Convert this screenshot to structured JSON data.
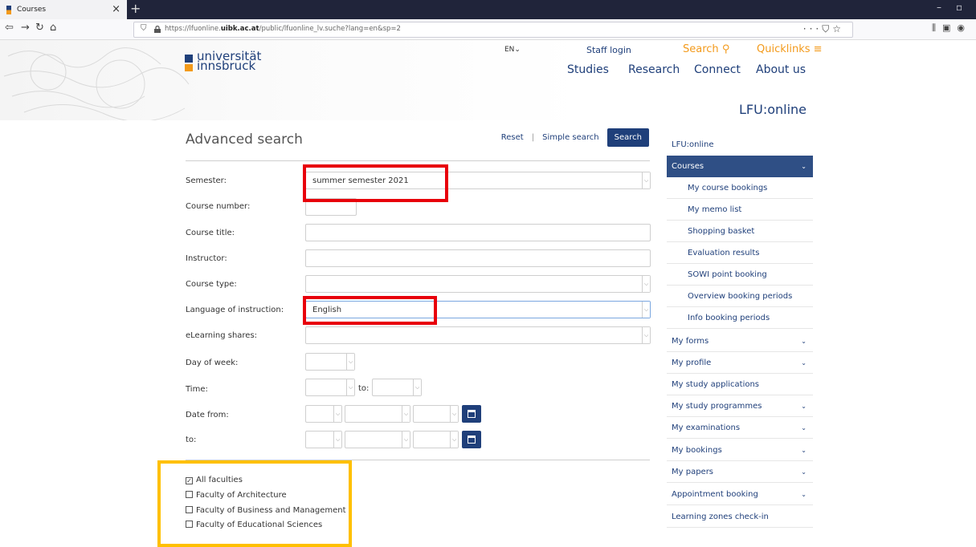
{
  "browser": {
    "tab_title": "Courses",
    "url_prefix": "https://lfuonline.",
    "url_domain": "uibk.ac.at",
    "url_rest": "/public/lfuonline_lv.suche?lang=en&sp=2",
    "new_tab": "+",
    "tab_close": "×"
  },
  "header": {
    "logo_line1": "universität",
    "logo_line2": "innsbruck",
    "lang": "EN",
    "staff_login": "Staff login",
    "search": "Search",
    "quicklinks": "Quicklinks",
    "nav": [
      "Studies",
      "Research",
      "Connect",
      "About us"
    ],
    "portal_title": "LFU:online"
  },
  "form": {
    "title": "Advanced search",
    "reset": "Reset",
    "divider": "|",
    "simple_search": "Simple search",
    "search_button": "Search",
    "labels": {
      "semester": "Semester:",
      "course_number": "Course number:",
      "course_title": "Course title:",
      "instructor": "Instructor:",
      "course_type": "Course type:",
      "language": "Language of instruction:",
      "elearning": "eLearning shares:",
      "day_of_week": "Day of week:",
      "time": "Time:",
      "time_to": "to:",
      "date_from": "Date from:",
      "date_to": "to:"
    },
    "values": {
      "semester": "summer semester 2021",
      "language": "English"
    },
    "faculties": [
      {
        "label": "All faculties",
        "checked": true
      },
      {
        "label": "Faculty of Architecture",
        "checked": false
      },
      {
        "label": "Faculty of Business and Management",
        "checked": false
      },
      {
        "label": "Faculty of Educational Sciences",
        "checked": false
      }
    ]
  },
  "sidebar": {
    "heading": "LFU:online",
    "items": [
      {
        "label": "Courses",
        "active": true,
        "expandable": true,
        "sub": false
      },
      {
        "label": "My course bookings",
        "sub": true
      },
      {
        "label": "My memo list",
        "sub": true
      },
      {
        "label": "Shopping basket",
        "sub": true
      },
      {
        "label": "Evaluation results",
        "sub": true
      },
      {
        "label": "SOWI point booking",
        "sub": true
      },
      {
        "label": "Overview booking periods",
        "sub": true
      },
      {
        "label": "Info booking periods",
        "sub": true
      },
      {
        "label": "My forms",
        "expandable": true
      },
      {
        "label": "My profile",
        "expandable": true
      },
      {
        "label": "My study applications",
        "expandable": false
      },
      {
        "label": "My study programmes",
        "expandable": true
      },
      {
        "label": "My examinations",
        "expandable": true
      },
      {
        "label": "My bookings",
        "expandable": true
      },
      {
        "label": "My papers",
        "expandable": true
      },
      {
        "label": "Appointment booking",
        "expandable": true
      },
      {
        "label": "Learning zones check-in",
        "expandable": false
      }
    ]
  },
  "colors": {
    "brand_blue": "#1f3f7a",
    "brand_orange": "#f39a1b",
    "highlight_red": "#e8000b",
    "highlight_yellow": "#ffc000"
  }
}
